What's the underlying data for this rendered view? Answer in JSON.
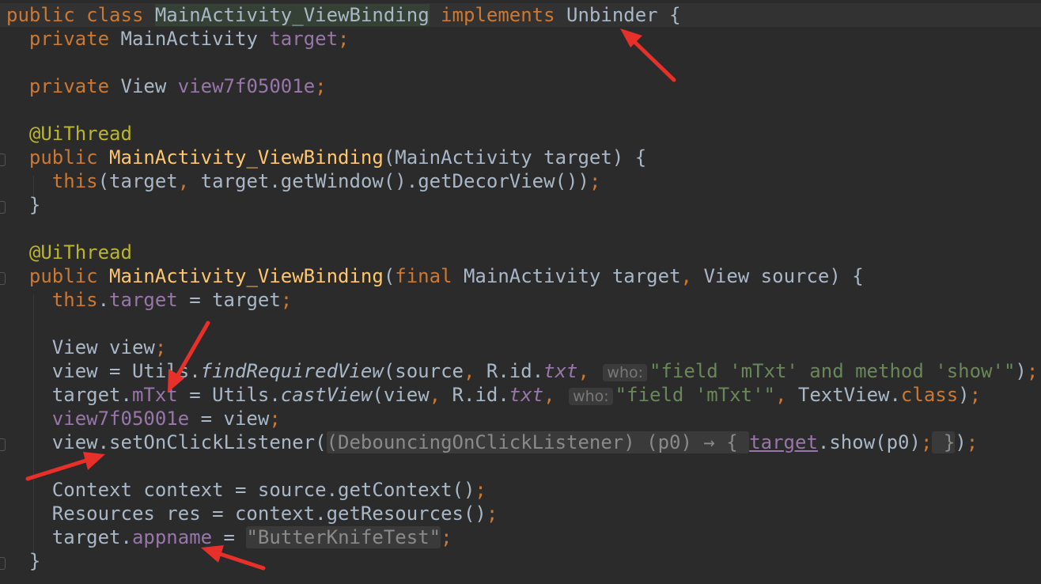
{
  "editor": {
    "lines": [
      {
        "id": "l1",
        "tokens": [
          [
            "public ",
            "kw"
          ],
          [
            "class ",
            "kw"
          ],
          [
            "MainActivity_ViewBinding",
            "hl-class"
          ],
          [
            " implements ",
            "kw"
          ],
          [
            "Unbinder",
            ""
          ],
          [
            " {",
            ""
          ]
        ]
      },
      {
        "id": "l2",
        "tokens": [
          [
            "  private ",
            "kw"
          ],
          [
            "MainActivity ",
            ""
          ],
          [
            "target",
            "fld"
          ],
          [
            ";",
            "kw"
          ]
        ]
      },
      {
        "id": "l3",
        "tokens": []
      },
      {
        "id": "l4",
        "tokens": [
          [
            "  private ",
            "kw"
          ],
          [
            "View ",
            ""
          ],
          [
            "view7f05001e",
            "fld"
          ],
          [
            ";",
            "kw"
          ]
        ]
      },
      {
        "id": "l5",
        "tokens": []
      },
      {
        "id": "l6",
        "tokens": [
          [
            "  @UiThread",
            "ann"
          ]
        ]
      },
      {
        "id": "l7",
        "tokens": [
          [
            "  public ",
            "kw"
          ],
          [
            "MainActivity_ViewBinding",
            "fn"
          ],
          [
            "(MainActivity target) {",
            ""
          ]
        ]
      },
      {
        "id": "l8",
        "tokens": [
          [
            "    this",
            "kw"
          ],
          [
            "(target",
            ""
          ],
          [
            ", ",
            "kw"
          ],
          [
            "target.getWindow().getDecorView())",
            ""
          ],
          [
            ";",
            "kw"
          ]
        ]
      },
      {
        "id": "l9",
        "tokens": [
          [
            "  }",
            ""
          ]
        ]
      },
      {
        "id": "l10",
        "tokens": []
      },
      {
        "id": "l11",
        "tokens": [
          [
            "  @UiThread",
            "ann"
          ]
        ]
      },
      {
        "id": "l12",
        "tokens": [
          [
            "  public ",
            "kw"
          ],
          [
            "MainActivity_ViewBinding",
            "fn"
          ],
          [
            "(",
            ""
          ],
          [
            "final ",
            "kw"
          ],
          [
            "MainActivity target",
            ""
          ],
          [
            ", ",
            "kw"
          ],
          [
            "View source) {",
            ""
          ]
        ]
      },
      {
        "id": "l13",
        "tokens": [
          [
            "    this",
            "kw"
          ],
          [
            ".",
            ""
          ],
          [
            "target",
            "fld"
          ],
          [
            " = target",
            ""
          ],
          [
            ";",
            "kw"
          ]
        ]
      },
      {
        "id": "l14",
        "tokens": []
      },
      {
        "id": "l15",
        "tokens": [
          [
            "    View view",
            ""
          ],
          [
            ";",
            "kw"
          ]
        ]
      },
      {
        "id": "l16",
        "tokens": [
          [
            "    view = Utils.",
            ""
          ],
          [
            "findRequiredView",
            "it"
          ],
          [
            "(source",
            ""
          ],
          [
            ", ",
            "kw"
          ],
          [
            "R.id.",
            ""
          ],
          [
            "txt",
            "fld it"
          ],
          [
            ", ",
            "kw"
          ],
          [
            "who:",
            "hint"
          ],
          [
            "\"field 'mTxt' and method 'show'\"",
            "str"
          ],
          [
            ")",
            ""
          ],
          [
            ";",
            "kw"
          ]
        ]
      },
      {
        "id": "l17",
        "tokens": [
          [
            "    target.",
            ""
          ],
          [
            "mTxt",
            "fld"
          ],
          [
            " = Utils.",
            ""
          ],
          [
            "castView",
            "it"
          ],
          [
            "(view",
            ""
          ],
          [
            ", ",
            "kw"
          ],
          [
            "R.id.",
            ""
          ],
          [
            "txt",
            "fld it"
          ],
          [
            ", ",
            "kw"
          ],
          [
            "who:",
            "hint"
          ],
          [
            "\"field 'mTxt'\"",
            "str"
          ],
          [
            ", ",
            "kw"
          ],
          [
            "TextView.",
            ""
          ],
          [
            "class",
            "kw"
          ],
          [
            ")",
            ""
          ],
          [
            ";",
            "kw"
          ]
        ]
      },
      {
        "id": "l18",
        "tokens": [
          [
            "    ",
            ""
          ],
          [
            "view7f05001e",
            "fld"
          ],
          [
            " = view",
            ""
          ],
          [
            ";",
            "kw"
          ]
        ]
      },
      {
        "id": "l19",
        "tokens": [
          [
            "    view.setOnClickListener(",
            ""
          ],
          [
            "(DebouncingOnClickListener) (p0) → { ",
            "folded"
          ],
          [
            "target",
            "fld underline"
          ],
          [
            ".show(p0)",
            ""
          ],
          [
            ";",
            "kw"
          ],
          [
            " }",
            "folded"
          ],
          [
            ")",
            ""
          ],
          [
            ";",
            "kw"
          ]
        ]
      },
      {
        "id": "l20",
        "tokens": []
      },
      {
        "id": "l21",
        "tokens": [
          [
            "    Context context = source.getContext()",
            ""
          ],
          [
            ";",
            "kw"
          ]
        ]
      },
      {
        "id": "l22",
        "tokens": [
          [
            "    Resources res = context.getResources()",
            ""
          ],
          [
            ";",
            "kw"
          ]
        ]
      },
      {
        "id": "l23",
        "tokens": [
          [
            "    target.",
            ""
          ],
          [
            "appname",
            "fld"
          ],
          [
            " = ",
            ""
          ],
          [
            "\"ButterKnifeTest\"",
            "str folded"
          ],
          [
            ";",
            "kw"
          ]
        ]
      },
      {
        "id": "l24",
        "tokens": [
          [
            "  }",
            ""
          ]
        ]
      }
    ]
  }
}
